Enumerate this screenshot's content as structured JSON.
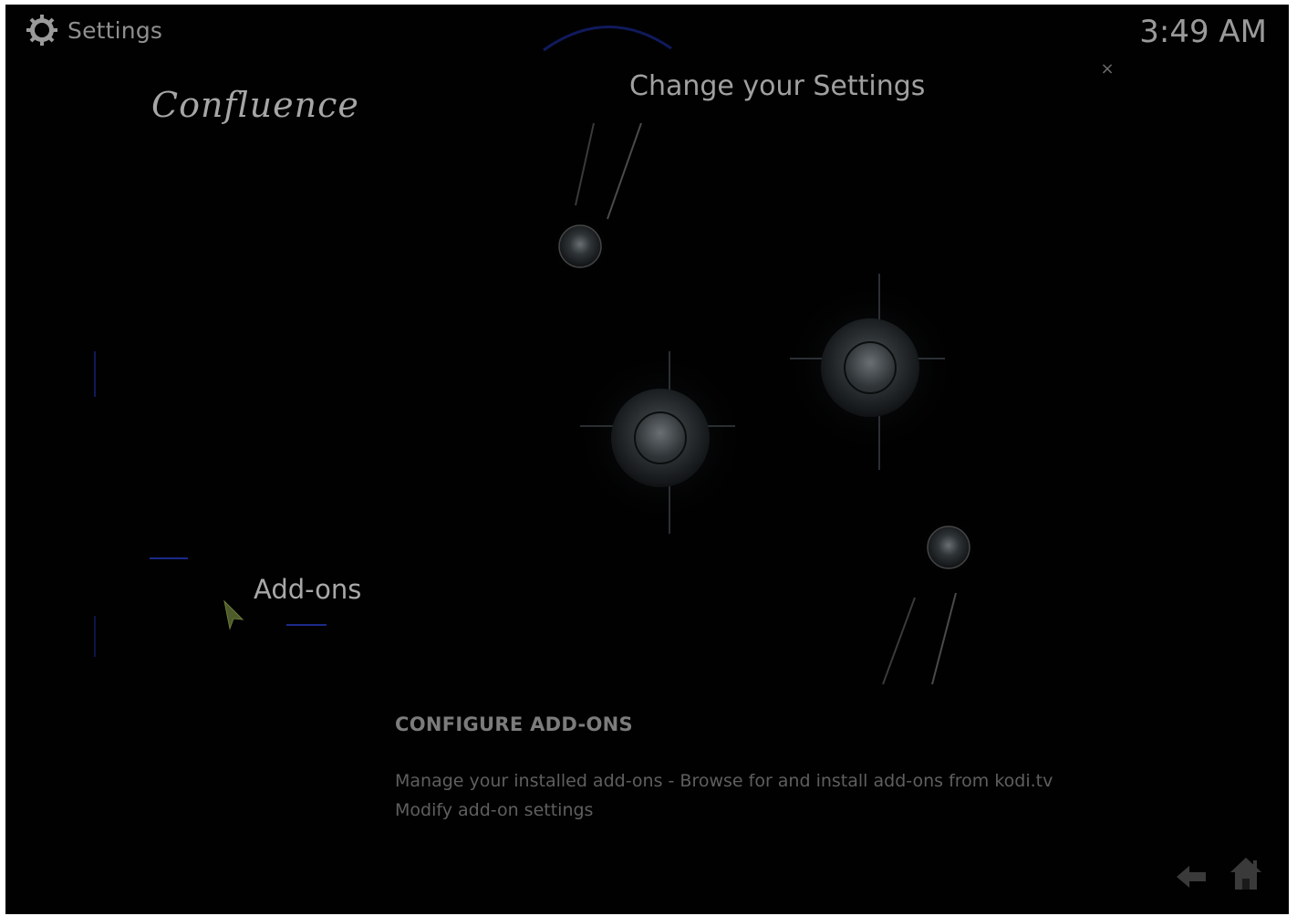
{
  "header": {
    "title": "Settings",
    "clock": "3:49 AM",
    "icon": "gear-icon",
    "close_label": "×"
  },
  "skin": {
    "logo_text": "Confluence"
  },
  "page": {
    "heading": "Change your Settings"
  },
  "menu": {
    "selected_item": "Add-ons"
  },
  "description": {
    "heading": "CONFIGURE ADD-ONS",
    "line1": "Manage your installed add-ons - Browse for and install add-ons from kodi.tv",
    "line2": "Modify add-on settings"
  },
  "footer": {
    "back_icon": "back-arrow-icon",
    "home_icon": "home-icon"
  },
  "colors": {
    "background": "#010101",
    "text": "#a8a8a8",
    "accent_blue": "#1b2a8a"
  }
}
